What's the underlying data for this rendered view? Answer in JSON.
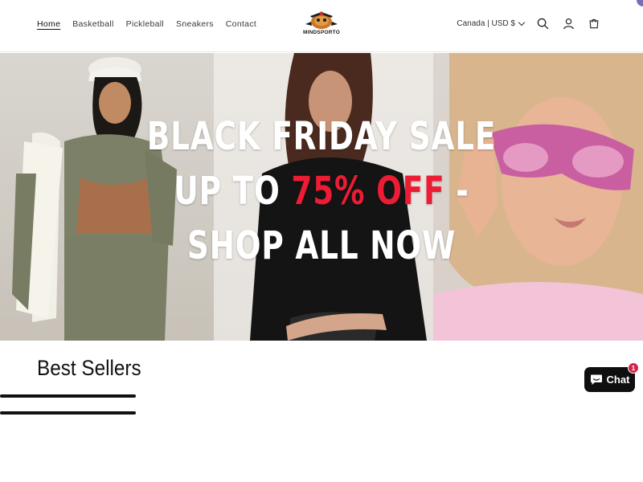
{
  "nav": {
    "items": [
      {
        "label": "Home",
        "active": true
      },
      {
        "label": "Basketball"
      },
      {
        "label": "Pickleball"
      },
      {
        "label": "Sneakers"
      },
      {
        "label": "Contact"
      }
    ]
  },
  "logo": {
    "text": "MINDSPORTO"
  },
  "header": {
    "currency_label": "Canada | USD $",
    "icons": [
      "search-icon",
      "account-icon",
      "cart-icon"
    ]
  },
  "hero": {
    "line1": "BLACK FRIDAY SALE",
    "line2_prefix": "UP TO ",
    "line2_highlight": "75% OFF",
    "line2_suffix": " -",
    "line3": "SHOP ALL NOW",
    "highlight_color": "#ec1c34"
  },
  "section": {
    "title": "Best Sellers"
  },
  "chat": {
    "label": "Chat",
    "badge": "1"
  }
}
